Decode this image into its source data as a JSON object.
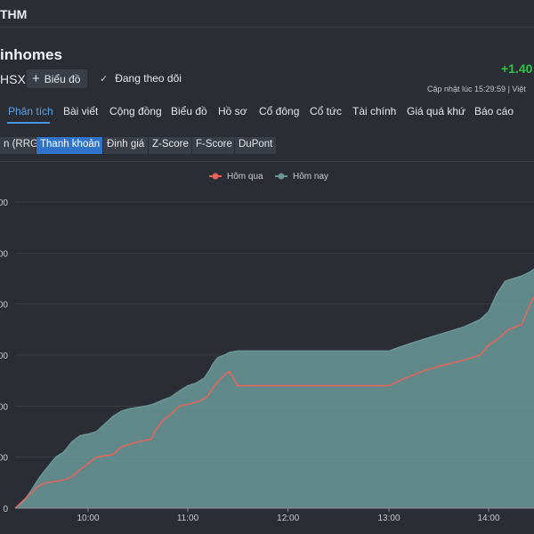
{
  "header": {
    "ticker": "THM"
  },
  "stock": {
    "name": "inhomes",
    "exchange": "HSX",
    "chart_button_label": "Biểu đồ",
    "follow_label": "Đang theo dõi",
    "change": "+1.40",
    "updated": "Cập nhật lúc  15:29:59 | Việt"
  },
  "tabs": [
    {
      "label": "Phân tích",
      "active": true
    },
    {
      "label": "Bài viết"
    },
    {
      "label": "Cộng đồng"
    },
    {
      "label": "Biểu đồ"
    },
    {
      "label": "Hồ sơ"
    },
    {
      "label": "Cổ đông"
    },
    {
      "label": "Cổ tức"
    },
    {
      "label": "Tài chính"
    },
    {
      "label": "Giá quá khứ"
    },
    {
      "label": "Báo cáo"
    }
  ],
  "subtabs": [
    {
      "label": "n (RRG)"
    },
    {
      "label": "Thanh khoản",
      "active": true
    },
    {
      "label": "Định giá"
    },
    {
      "label": "Z-Score"
    },
    {
      "label": "F-Score"
    },
    {
      "label": "DuPont"
    }
  ],
  "colors": {
    "yesterday": "#e8645a",
    "today": "#6a9696",
    "fill": "#6b9a9a"
  },
  "chart_data": {
    "type": "area",
    "x_ticks": [
      "10:00",
      "11:00",
      "12:00",
      "13:00",
      "14:00"
    ],
    "y_tick_labels": [
      "00",
      "00",
      "00",
      "00",
      "00",
      "00",
      "0"
    ],
    "ylim": [
      0,
      6
    ],
    "grid": true,
    "legend_position": "top-center",
    "series": [
      {
        "name": "Hôm qua",
        "points": [
          [
            "9:15",
            0
          ],
          [
            "9:25",
            0.3
          ],
          [
            "9:30",
            0.45
          ],
          [
            "9:35",
            0.5
          ],
          [
            "9:45",
            0.55
          ],
          [
            "9:50",
            0.62
          ],
          [
            "9:55",
            0.75
          ],
          [
            "10:05",
            1.0
          ],
          [
            "10:15",
            1.05
          ],
          [
            "10:20",
            1.2
          ],
          [
            "10:30",
            1.3
          ],
          [
            "10:38",
            1.35
          ],
          [
            "10:40",
            1.5
          ],
          [
            "10:45",
            1.72
          ],
          [
            "10:50",
            1.85
          ],
          [
            "10:55",
            2.0
          ],
          [
            "11:05",
            2.07
          ],
          [
            "11:10",
            2.15
          ],
          [
            "11:12",
            2.2
          ],
          [
            "11:15",
            2.35
          ],
          [
            "11:20",
            2.55
          ],
          [
            "11:25",
            2.68
          ],
          [
            "11:30",
            2.4
          ],
          [
            "11:59",
            2.4
          ],
          [
            "13:00",
            2.4
          ],
          [
            "13:10",
            2.55
          ],
          [
            "13:20",
            2.68
          ],
          [
            "13:30",
            2.78
          ],
          [
            "13:45",
            2.9
          ],
          [
            "13:55",
            3.0
          ],
          [
            "14:00",
            3.2
          ],
          [
            "14:05",
            3.3
          ],
          [
            "14:12",
            3.5
          ],
          [
            "14:20",
            3.6
          ],
          [
            "14:25",
            4.0
          ],
          [
            "14:30",
            4.3
          ]
        ]
      },
      {
        "name": "Hôm nay",
        "points": [
          [
            "9:15",
            0
          ],
          [
            "9:20",
            0.12
          ],
          [
            "9:25",
            0.35
          ],
          [
            "9:30",
            0.6
          ],
          [
            "9:35",
            0.8
          ],
          [
            "9:40",
            1.0
          ],
          [
            "9:45",
            1.1
          ],
          [
            "9:50",
            1.3
          ],
          [
            "9:55",
            1.42
          ],
          [
            "10:00",
            1.45
          ],
          [
            "10:05",
            1.5
          ],
          [
            "10:10",
            1.65
          ],
          [
            "10:15",
            1.8
          ],
          [
            "10:20",
            1.9
          ],
          [
            "10:25",
            1.95
          ],
          [
            "10:35",
            2.0
          ],
          [
            "10:40",
            2.05
          ],
          [
            "10:45",
            2.12
          ],
          [
            "10:50",
            2.18
          ],
          [
            "10:55",
            2.3
          ],
          [
            "11:00",
            2.4
          ],
          [
            "11:05",
            2.45
          ],
          [
            "11:10",
            2.55
          ],
          [
            "11:13",
            2.7
          ],
          [
            "11:15",
            2.82
          ],
          [
            "11:18",
            2.95
          ],
          [
            "11:22",
            3.0
          ],
          [
            "11:25",
            3.05
          ],
          [
            "11:30",
            3.08
          ],
          [
            "11:59",
            3.08
          ],
          [
            "13:00",
            3.08
          ],
          [
            "13:05",
            3.14
          ],
          [
            "13:15",
            3.25
          ],
          [
            "13:25",
            3.35
          ],
          [
            "13:35",
            3.45
          ],
          [
            "13:45",
            3.55
          ],
          [
            "13:55",
            3.7
          ],
          [
            "14:00",
            3.85
          ],
          [
            "14:05",
            4.2
          ],
          [
            "14:10",
            4.45
          ],
          [
            "14:20",
            4.55
          ],
          [
            "14:25",
            4.63
          ],
          [
            "14:30",
            4.75
          ]
        ]
      }
    ]
  }
}
